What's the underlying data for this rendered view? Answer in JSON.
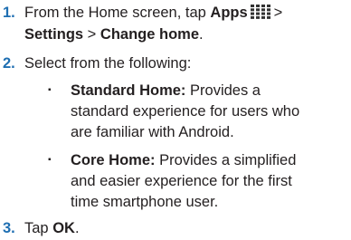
{
  "steps": [
    {
      "number": "1.",
      "line1_prefix": "From the Home screen, tap ",
      "apps_label": "Apps",
      "apps_icon": "apps-grid-icon",
      "gt1": ">",
      "settings_label": "Settings",
      "gt2": " > ",
      "change_home_label": "Change home",
      "period": "."
    },
    {
      "number": "2.",
      "text": "Select from the following:"
    },
    {
      "number": "3.",
      "tap_prefix": "Tap ",
      "ok_label": "OK",
      "period": "."
    }
  ],
  "options": [
    {
      "bullet": "▪",
      "title": "Standard Home:",
      "line1": " Provides a",
      "line2": "standard experience for users who",
      "line3": "are familiar with Android."
    },
    {
      "bullet": "▪",
      "title": "Core Home:",
      "line1": " Provides a simplified",
      "line2": "and easier experience for the first",
      "line3": "time smartphone user."
    }
  ],
  "colors": {
    "step_number": "#1f6fb2",
    "text": "#231f20",
    "icon": "#333333"
  }
}
